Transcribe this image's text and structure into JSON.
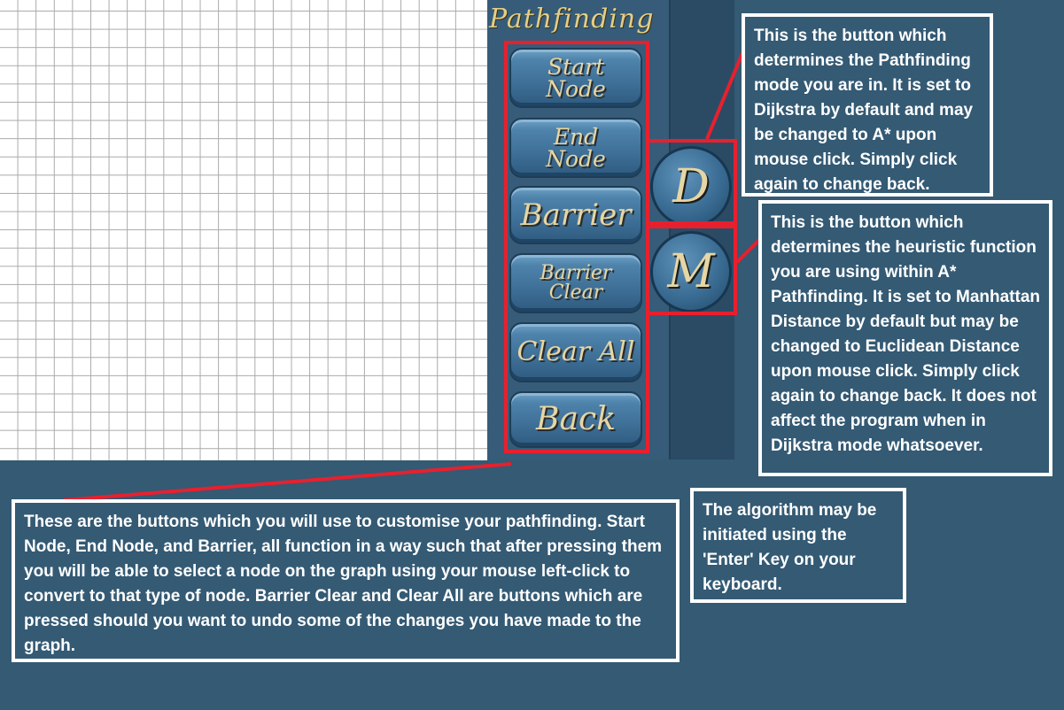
{
  "panel": {
    "title": "Pathfinding",
    "buttons": [
      {
        "id": "start-node",
        "label": "Start\nNode"
      },
      {
        "id": "end-node",
        "label": "End\nNode"
      },
      {
        "id": "barrier",
        "label": "Barrier"
      },
      {
        "id": "barrier-clear",
        "label": "Barrier\nClear"
      },
      {
        "id": "clear-all",
        "label": "Clear All"
      },
      {
        "id": "back",
        "label": "Back"
      }
    ],
    "mode_button": "D",
    "heuristic_button": "M"
  },
  "annotations": {
    "mode": "This is the button which determines the Pathfinding mode you are in. It is set to Dijkstra by default and may be changed to A* upon mouse click. Simply click again to change back.",
    "heuristic": "This is the button which determines the heuristic function you are using within A* Pathfinding. It is set to Manhattan Distance by default but may be changed to Euclidean Distance upon mouse click. Simply click again to change back. It does not affect the program when in Dijkstra mode whatsoever.",
    "buttons": "These are the buttons which you will use to customise your pathfinding. Start Node, End Node, and Barrier, all function in a way such that after pressing them you will be able to select a node on the graph using your mouse left-click to convert to that type of node. Barrier Clear and Clear All are buttons which are pressed should you want to undo some of the changes you have made to the graph.",
    "enter": "The algorithm may be initiated using the 'Enter' Key on your keyboard."
  },
  "colors": {
    "background": "#345A74",
    "highlight": "#E8202E",
    "button_text": "#E6D6A4"
  }
}
